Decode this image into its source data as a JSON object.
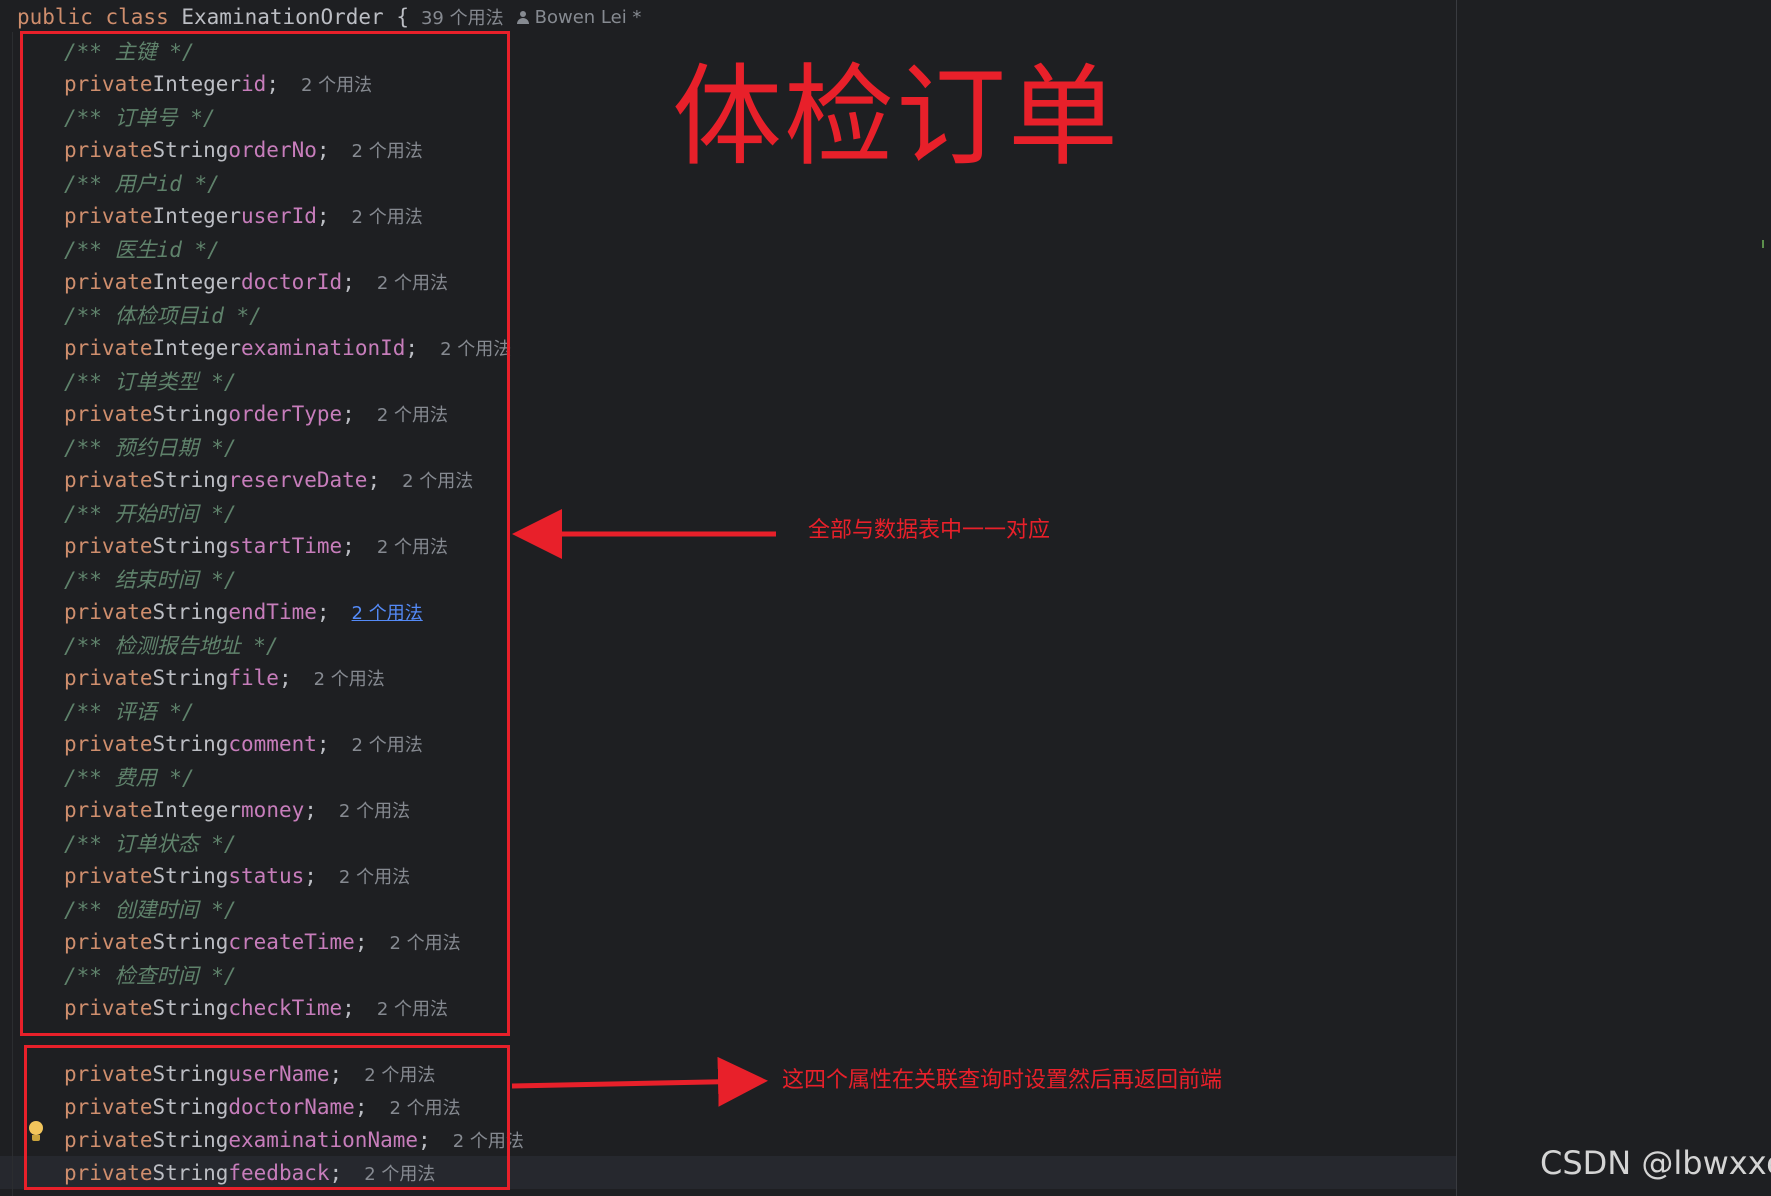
{
  "header": {
    "keywords": "public class",
    "class_name": "ExaminationOrder",
    "brace": "{",
    "usages": "39 个用法",
    "author": "Bowen Lei *"
  },
  "fields": [
    {
      "comment": "/** 主键 */",
      "keyword": "private",
      "type": "Integer",
      "name": "id",
      "usages": "2 个用法",
      "link": false
    },
    {
      "comment": "/** 订单号 */",
      "keyword": "private",
      "type": "String",
      "name": "orderNo",
      "usages": "2 个用法",
      "link": false
    },
    {
      "comment": "/** 用户id */",
      "keyword": "private",
      "type": "Integer",
      "name": "userId",
      "usages": "2 个用法",
      "link": false
    },
    {
      "comment": "/** 医生id */",
      "keyword": "private",
      "type": "Integer",
      "name": "doctorId",
      "usages": "2 个用法",
      "link": false
    },
    {
      "comment": "/** 体检项目id */",
      "keyword": "private",
      "type": "Integer",
      "name": "examinationId",
      "usages": "2 个用法",
      "link": false
    },
    {
      "comment": "/** 订单类型 */",
      "keyword": "private",
      "type": "String",
      "name": "orderType",
      "usages": "2 个用法",
      "link": false
    },
    {
      "comment": "/** 预约日期 */",
      "keyword": "private",
      "type": "String",
      "name": "reserveDate",
      "usages": "2 个用法",
      "link": false
    },
    {
      "comment": "/** 开始时间 */",
      "keyword": "private",
      "type": "String",
      "name": "startTime",
      "usages": "2 个用法",
      "link": false
    },
    {
      "comment": "/** 结束时间 */",
      "keyword": "private",
      "type": "String",
      "name": "endTime",
      "usages": "2 个用法",
      "link": true
    },
    {
      "comment": "/** 检测报告地址 */",
      "keyword": "private",
      "type": "String",
      "name": "file",
      "usages": "2 个用法",
      "link": false
    },
    {
      "comment": "/** 评语 */",
      "keyword": "private",
      "type": "String",
      "name": "comment",
      "usages": "2 个用法",
      "link": false
    },
    {
      "comment": "/** 费用 */",
      "keyword": "private",
      "type": "Integer",
      "name": "money",
      "usages": "2 个用法",
      "link": false
    },
    {
      "comment": "/** 订单状态 */",
      "keyword": "private",
      "type": "String",
      "name": "status",
      "usages": "2 个用法",
      "link": false
    },
    {
      "comment": "/** 创建时间 */",
      "keyword": "private",
      "type": "String",
      "name": "createTime",
      "usages": "2 个用法",
      "link": false
    },
    {
      "comment": "/** 检查时间 */",
      "keyword": "private",
      "type": "String",
      "name": "checkTime",
      "usages": "2 个用法",
      "link": false
    }
  ],
  "extra_fields": [
    {
      "keyword": "private",
      "type": "String",
      "name": "userName",
      "usages": "2 个用法"
    },
    {
      "keyword": "private",
      "type": "String",
      "name": "doctorName",
      "usages": "2 个用法"
    },
    {
      "keyword": "private",
      "type": "String",
      "name": "examinationName",
      "usages": "2 个用法"
    },
    {
      "keyword": "private",
      "type": "String",
      "name": "feedback",
      "usages": "2 个用法"
    }
  ],
  "annotations": {
    "title": "体检订单",
    "note_mapping": "全部与数据表中一一对应",
    "note_join": "这四个属性在关联查询时设置然后再返回前端"
  },
  "watermark": "CSDN @lbwxxc",
  "icons": {
    "author": "person-icon",
    "intention": "lightbulb-icon"
  },
  "colors": {
    "background": "#1e1f22",
    "keyword": "#cf8e6d",
    "field": "#c77dbb",
    "comment": "#5f826b",
    "hint": "#868a91",
    "link": "#548af7",
    "annotation_red": "#e8202a"
  }
}
